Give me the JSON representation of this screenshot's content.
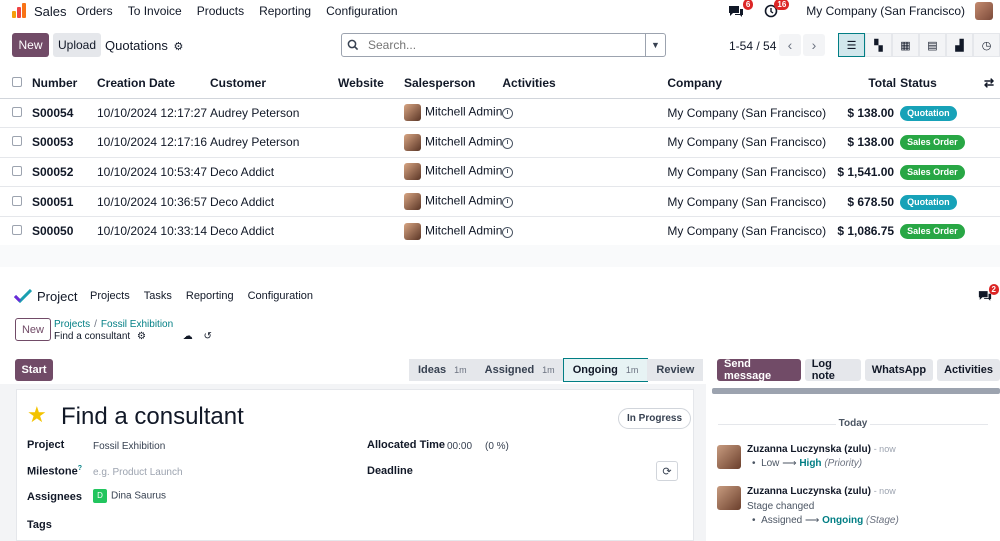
{
  "sales": {
    "app_name": "Sales",
    "menu": [
      "Orders",
      "To Invoice",
      "Products",
      "Reporting",
      "Configuration"
    ],
    "activity_badge": "6",
    "clock_badge": "16",
    "company": "My Company (San Francisco)",
    "new_label": "New",
    "upload_label": "Upload",
    "view_title": "Quotations",
    "search_placeholder": "Search...",
    "pager": "1-54 / 54",
    "columns": [
      "Number",
      "Creation Date",
      "Customer",
      "Website",
      "Salesperson",
      "Activities",
      "Company",
      "Total",
      "Status"
    ],
    "rows": [
      {
        "number": "S00054",
        "date": "10/10/2024 12:17:27",
        "customer": "Audrey Peterson",
        "salesperson": "Mitchell Admin",
        "company": "My Company (San Francisco)",
        "total": "$ 138.00",
        "status": "Quotation"
      },
      {
        "number": "S00053",
        "date": "10/10/2024 12:17:16",
        "customer": "Audrey Peterson",
        "salesperson": "Mitchell Admin",
        "company": "My Company (San Francisco)",
        "total": "$ 138.00",
        "status": "Sales Order"
      },
      {
        "number": "S00052",
        "date": "10/10/2024 10:53:47",
        "customer": "Deco Addict",
        "salesperson": "Mitchell Admin",
        "company": "My Company (San Francisco)",
        "total": "$ 1,541.00",
        "status": "Sales Order"
      },
      {
        "number": "S00051",
        "date": "10/10/2024 10:36:57",
        "customer": "Deco Addict",
        "salesperson": "Mitchell Admin",
        "company": "My Company (San Francisco)",
        "total": "$ 678.50",
        "status": "Quotation"
      },
      {
        "number": "S00050",
        "date": "10/10/2024 10:33:14",
        "customer": "Deco Addict",
        "salesperson": "Mitchell Admin",
        "company": "My Company (San Francisco)",
        "total": "$ 1,086.75",
        "status": "Sales Order"
      }
    ],
    "colors": {
      "accent": "#714b67",
      "quotation": "#17a2b8",
      "sales_order": "#28a745",
      "link": "#017e84"
    }
  },
  "project": {
    "app_name": "Project",
    "menu": [
      "Projects",
      "Tasks",
      "Reporting",
      "Configuration"
    ],
    "chat_badge": "2",
    "new_label": "New",
    "breadcrumb": [
      "Projects",
      "Fossil Exhibition"
    ],
    "record_name": "Find a consultant",
    "start_label": "Start",
    "stages": [
      {
        "name": "Ideas",
        "dur": "1m"
      },
      {
        "name": "Assigned",
        "dur": "1m"
      },
      {
        "name": "Ongoing",
        "dur": "1m"
      },
      {
        "name": "Review",
        "dur": ""
      }
    ],
    "chatter_buttons": [
      "Send message",
      "Log note",
      "WhatsApp",
      "Activities"
    ],
    "task": {
      "title": "Find a consultant",
      "state": "In Progress",
      "project_label": "Project",
      "project_value": "Fossil Exhibition",
      "milestone_label": "Milestone",
      "milestone_placeholder": "e.g. Product Launch",
      "assignees_label": "Assignees",
      "assignee": "Dina Saurus",
      "assignee_initial": "D",
      "tags_label": "Tags",
      "allocated_label": "Allocated Time",
      "allocated_value": "00:00",
      "allocated_pct": "(0 %)",
      "deadline_label": "Deadline"
    },
    "chatter": {
      "day": "Today",
      "messages": [
        {
          "author": "Zuzanna Luczynska (zulu)",
          "ago": "- now",
          "from": "Low",
          "to": "High",
          "field": "(Priority)"
        },
        {
          "author": "Zuzanna Luczynska (zulu)",
          "ago": "- now",
          "note": "Stage changed",
          "from": "Assigned",
          "to": "Ongoing",
          "field": "(Stage)"
        }
      ]
    }
  }
}
